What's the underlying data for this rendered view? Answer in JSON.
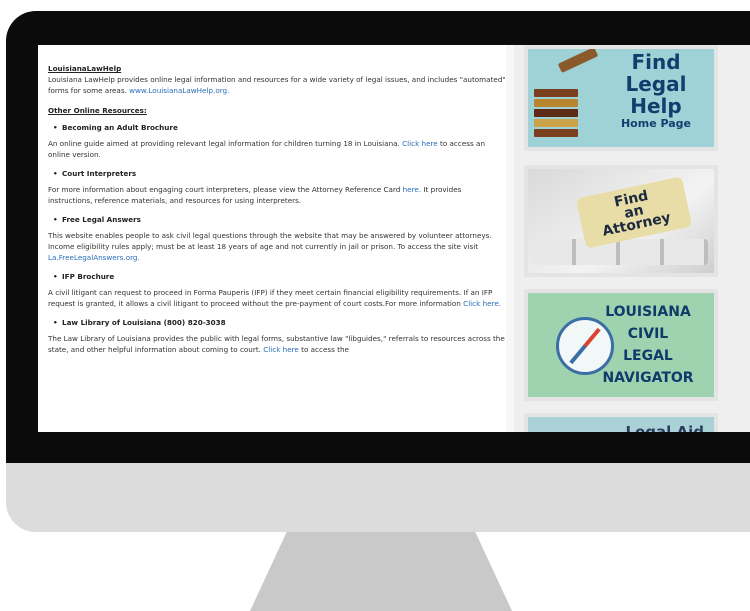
{
  "header": {
    "title": "LouisianaLawHelp"
  },
  "intro": {
    "text": "Louisiana LawHelp provides online legal information and resources for a wide variety of legal issues, and includes \"automated\" forms for some areas.",
    "link": "www.LouisianaLawHelp.org."
  },
  "other_resources": {
    "title": "Other Online Resources:"
  },
  "items": [
    {
      "title": "Becoming an Adult Brochure",
      "text": "An online guide aimed at providing relevant legal information for children turning 18 in Louisiana.",
      "link": "Click here",
      "text2": "to access an online version."
    },
    {
      "title": "Court Interpreters",
      "text": "For more information about engaging court interpreters, please view the Attorney Reference Card",
      "link": "here.",
      "text2": "It provides instructions, reference materials, and resources for using interpreters."
    },
    {
      "title": "Free Legal Answers",
      "text": "This website enables people to ask civil legal questions through the website that may be answered by volunteer attorneys. Income eligibility rules apply; must be at least 18 years of age and not currently in jail or prison. To access the site visit",
      "link": "La.FreeLegalAnswers.org."
    },
    {
      "title": "IFP Brochure",
      "text": "A civil litigant can request to proceed in Forma Pauperis (IFP) if they meet certain financial eligibility requirements. If an IFP request is granted, it allows a civil litigant to proceed without the pre-payment of court costs.For more information",
      "link": "Click here."
    },
    {
      "title": "Law Library of Louisiana (800) 820-3038",
      "text": "The Law Library of Louisiana provides the public with legal forms, substantive law \"libguides,\" referrals to resources across the state, and other helpful information about coming to court.",
      "link": "Click here",
      "text2": "to access the"
    }
  ],
  "sidebar": {
    "find_legal_help": {
      "line1": "Find",
      "line2": "Legal",
      "line3": "Help",
      "sub": "Home Page"
    },
    "find_attorney": {
      "line1": "Find",
      "line2": "an",
      "line3": "Attorney"
    },
    "navigator": {
      "line1": "LOUISIANA",
      "line2": "CIVIL",
      "line3": "LEGAL",
      "line4": "NAVIGATOR"
    },
    "legal_aid": {
      "text": "Legal Aid"
    }
  },
  "colors": {
    "link": "#2a6ebb",
    "monitor_frame": "#0b0b0b",
    "monitor_body": "#dcdcdc"
  }
}
